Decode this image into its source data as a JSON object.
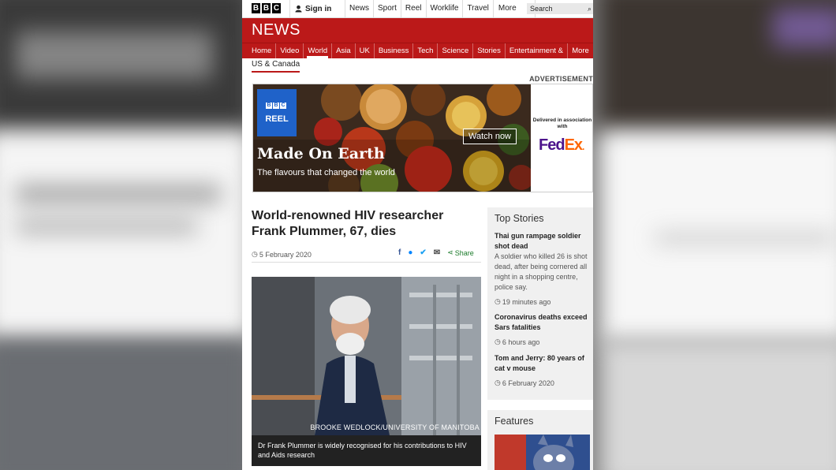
{
  "topbar": {
    "logo_letters": [
      "B",
      "B",
      "C"
    ],
    "signin": "Sign in",
    "nav": [
      "News",
      "Sport",
      "Reel",
      "Worklife",
      "Travel"
    ],
    "more": "More",
    "search_placeholder": "Search"
  },
  "header": {
    "brand": "NEWS",
    "sections": [
      "Home",
      "Video",
      "World",
      "Asia",
      "UK",
      "Business",
      "Tech",
      "Science",
      "Stories",
      "Entertainment & Arts"
    ],
    "sections_more": "More",
    "active_section": "World",
    "subsection": "US & Canada"
  },
  "ad": {
    "label": "ADVERTISEMENT",
    "reel_letters": [
      "B",
      "B",
      "C"
    ],
    "reel_label": "REEL",
    "title": "Made On Earth",
    "tagline": "The flavours that changed the world",
    "cta": "Watch now",
    "sponsor_text": "Delivered in association with",
    "sponsor_fed": "Fed",
    "sponsor_ex": "Ex",
    "sponsor_ex_dot": "."
  },
  "article": {
    "headline": "World-renowned HIV researcher Frank Plummer, 67, dies",
    "date": "5 February 2020",
    "share_label": "Share",
    "photo_credit": "BROOKE WEDLOCK/UNIVERSITY OF MANITOBA",
    "caption": "Dr Frank Plummer is widely recognised for his contributions to HIV and Aids research"
  },
  "sidebar": {
    "title": "Top Stories",
    "stories": [
      {
        "title": "Thai gun rampage soldier shot dead",
        "summary": "A soldier who killed 26 is shot dead, after being cornered all night in a shopping centre, police say.",
        "time": "19 minutes ago"
      },
      {
        "title": "Coronavirus deaths exceed Sars fatalities",
        "summary": "",
        "time": "6 hours ago"
      },
      {
        "title": "Tom and Jerry: 80 years of cat v mouse",
        "summary": "",
        "time": "6 February 2020"
      }
    ],
    "features_title": "Features"
  },
  "colors": {
    "bbc_red": "#bb1919",
    "fedex_purple": "#4d148c",
    "fedex_orange": "#ff6600",
    "share_green": "#1a7a2a"
  }
}
